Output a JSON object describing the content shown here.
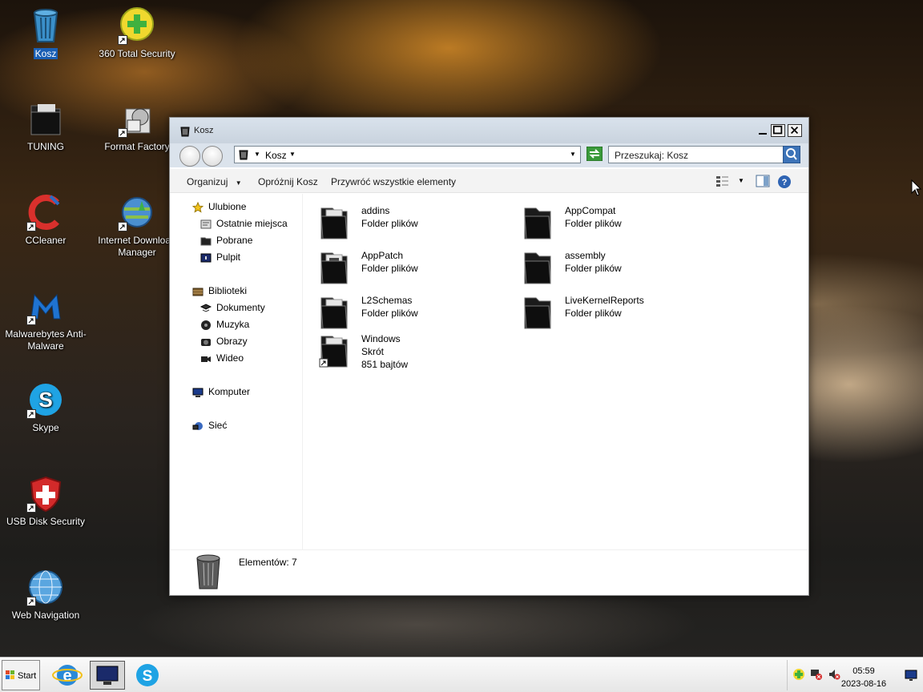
{
  "desktop_icons": [
    {
      "label": "Kosz",
      "icon": "recycle-bin-icon",
      "selected": true
    },
    {
      "label": "360 Total Security",
      "icon": "plus-shield-icon"
    },
    {
      "label": "TUNING",
      "icon": "folder-icon"
    },
    {
      "label": "Format Factory",
      "icon": "format-factory-icon"
    },
    {
      "label": "CCleaner",
      "icon": "ccleaner-icon"
    },
    {
      "label": "Internet Download Manager",
      "icon": "idm-globe-icon"
    },
    {
      "label": "Malwarebytes Anti-Malware",
      "icon": "malwarebytes-icon"
    },
    {
      "label": "Skype",
      "icon": "skype-icon"
    },
    {
      "label": "USB Disk Security",
      "icon": "shield-icon"
    },
    {
      "label": "Web Navigation",
      "icon": "globe-icon"
    }
  ],
  "window": {
    "title": "Kosz",
    "address": {
      "crumb": "Kosz"
    },
    "search": {
      "placeholder": "Przeszukaj: Kosz"
    },
    "toolbar": {
      "organize": "Organizuj",
      "empty_bin": "Opróżnij Kosz",
      "restore_all": "Przywróć wszystkie elementy"
    },
    "nav": {
      "favorites": "Ulubione",
      "recent": "Ostatnie miejsca",
      "downloads": "Pobrane",
      "desktop": "Pulpit",
      "libraries": "Biblioteki",
      "documents": "Dokumenty",
      "music": "Muzyka",
      "pictures": "Obrazy",
      "videos": "Wideo",
      "computer": "Komputer",
      "network": "Sieć"
    },
    "files": [
      {
        "name": "addins",
        "type": "Folder plików"
      },
      {
        "name": "AppCompat",
        "type": "Folder plików"
      },
      {
        "name": "AppPatch",
        "type": "Folder plików"
      },
      {
        "name": "assembly",
        "type": "Folder plików"
      },
      {
        "name": "L2Schemas",
        "type": "Folder plików"
      },
      {
        "name": "LiveKernelReports",
        "type": "Folder plików"
      },
      {
        "name": "Windows",
        "type": "Skrót",
        "size": "851 bajtów"
      }
    ],
    "details": {
      "count_text": "Elementów: 7"
    }
  },
  "taskbar": {
    "start_label": "Start",
    "clock_time": "05:59",
    "clock_date": "2023-08-16"
  }
}
